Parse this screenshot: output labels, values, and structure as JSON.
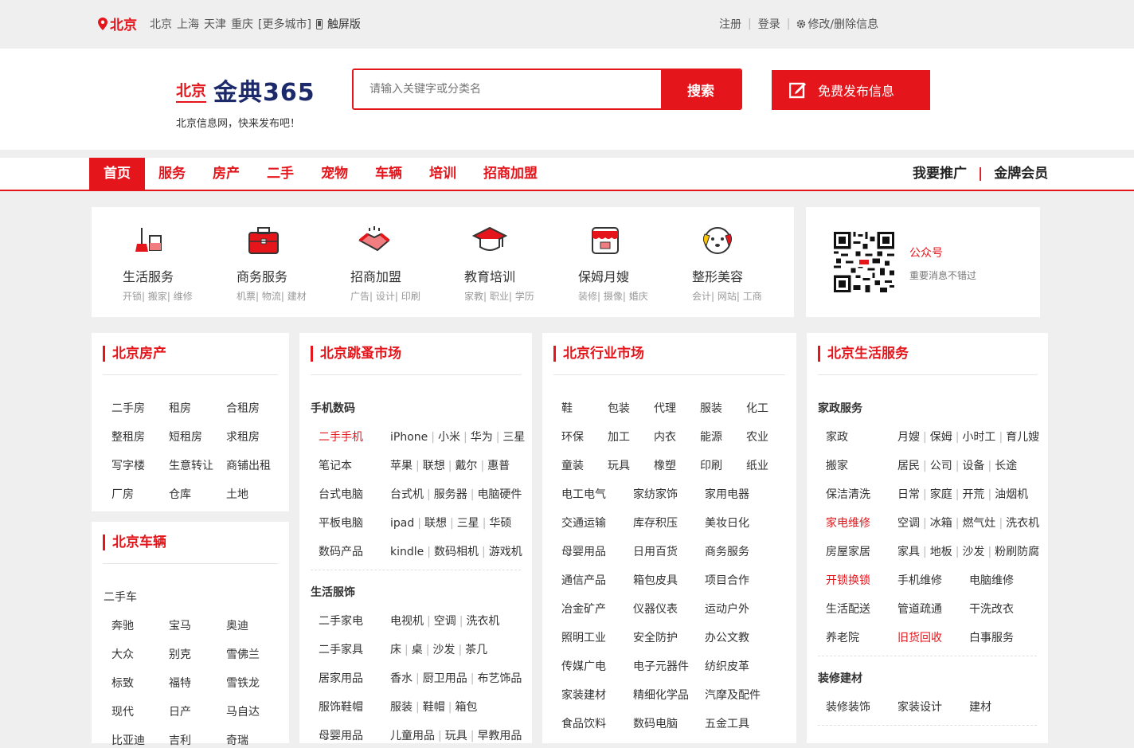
{
  "topbar": {
    "city": "北京",
    "cities": [
      "北京",
      "上海",
      "天津",
      "重庆"
    ],
    "more": "[更多城市]",
    "touch": "触屏版",
    "register": "注册",
    "login": "登录",
    "modify": "修改/删除信息"
  },
  "header": {
    "logo_city": "北京",
    "logo_name": "金典365",
    "slogan": "北京信息网，快来发布吧！",
    "search_placeholder": "请输入关键字或分类名",
    "search_button": "搜索",
    "publish_button": "免费发布信息"
  },
  "nav": {
    "items": [
      "首页",
      "服务",
      "房产",
      "二手",
      "宠物",
      "车辆",
      "培训",
      "招商加盟"
    ],
    "promote": "我要推广",
    "divider": "|",
    "gold": "金牌会员"
  },
  "categories": [
    {
      "name": "生活服务",
      "sub": "开锁| 搬家| 维修",
      "icon": "broom-icon"
    },
    {
      "name": "商务服务",
      "sub": "机票| 物流| 建材",
      "icon": "briefcase-icon"
    },
    {
      "name": "招商加盟",
      "sub": "广告| 设计| 印刷",
      "icon": "handshake-icon"
    },
    {
      "name": "教育培训",
      "sub": "家教| 职业| 学历",
      "icon": "graduation-cap-icon"
    },
    {
      "name": "保姆月嫂",
      "sub": "装修| 摄像| 婚庆",
      "icon": "storefront-icon"
    },
    {
      "name": "整形美容",
      "sub": "会计| 网站| 工商",
      "icon": "puppy-icon"
    }
  ],
  "wechat": {
    "title": "公众号",
    "desc": "重要消息不错过"
  },
  "house": {
    "title": "北京房产",
    "items": [
      "二手房",
      "租房",
      "合租房",
      "整租房",
      "短租房",
      "求租房",
      "写字楼",
      "生意转让",
      "商铺出租",
      "厂房",
      "仓库",
      "土地"
    ]
  },
  "vehicle": {
    "title": "北京车辆",
    "group": "二手车",
    "items": [
      "奔驰",
      "宝马",
      "奥迪",
      "大众",
      "别克",
      "雪佛兰",
      "标致",
      "福特",
      "雪铁龙",
      "现代",
      "日产",
      "马自达",
      "比亚迪",
      "吉利",
      "奇瑞"
    ]
  },
  "flea": {
    "title": "北京跳蚤市场",
    "group1": "手机数码",
    "rows1": [
      {
        "cat": "二手手机",
        "items": [
          "iPhone",
          "小米",
          "华为",
          "三星"
        ]
      },
      {
        "cat": "笔记本",
        "items": [
          "苹果",
          "联想",
          "戴尔",
          "惠普"
        ]
      },
      {
        "cat": "台式电脑",
        "items": [
          "台式机",
          "服务器",
          "电脑硬件"
        ]
      },
      {
        "cat": "平板电脑",
        "items": [
          "ipad",
          "联想",
          "三星",
          "华硕"
        ]
      },
      {
        "cat": "数码产品",
        "items": [
          "kindle",
          "数码相机",
          "游戏机"
        ]
      }
    ],
    "group2": "生活服饰",
    "rows2": [
      {
        "cat": "二手家电",
        "items": [
          "电视机",
          "空调",
          "洗衣机"
        ]
      },
      {
        "cat": "二手家具",
        "items": [
          "床",
          "桌",
          "沙发",
          "茶几"
        ]
      },
      {
        "cat": "居家用品",
        "items": [
          "香水",
          "厨卫用品",
          "布艺饰品"
        ]
      },
      {
        "cat": "服饰鞋帽",
        "items": [
          "服装",
          "鞋帽",
          "箱包"
        ]
      },
      {
        "cat": "母婴用品",
        "items": [
          "儿童用品",
          "玩具",
          "早教用品"
        ]
      }
    ]
  },
  "industry": {
    "title": "北京行业市场",
    "rows5": [
      [
        "鞋",
        "包装",
        "代理",
        "服装",
        "化工"
      ],
      [
        "环保",
        "加工",
        "内衣",
        "能源",
        "农业"
      ],
      [
        "童装",
        "玩具",
        "橡塑",
        "印刷",
        "纸业"
      ]
    ],
    "rows3": [
      [
        "电工电气",
        "家纺家饰",
        "家用电器"
      ],
      [
        "交通运输",
        "库存积压",
        "美妆日化"
      ],
      [
        "母婴用品",
        "日用百货",
        "商务服务"
      ],
      [
        "通信产品",
        "箱包皮具",
        "项目合作"
      ],
      [
        "冶金矿产",
        "仪器仪表",
        "运动户外"
      ],
      [
        "照明工业",
        "安全防护",
        "办公文教"
      ],
      [
        "传媒广电",
        "电子元器件",
        "纺织皮革"
      ],
      [
        "家装建材",
        "精细化学品",
        "汽摩及配件"
      ],
      [
        "食品饮料",
        "数码电脑",
        "五金工具"
      ]
    ]
  },
  "life": {
    "title": "北京生活服务",
    "group1": "家政服务",
    "rows1": [
      {
        "cat": "家政",
        "items": [
          "月嫂",
          "保姆",
          "小时工",
          "育儿嫂"
        ]
      },
      {
        "cat": "搬家",
        "items": [
          "居民",
          "公司",
          "设备",
          "长途"
        ]
      },
      {
        "cat": "保洁清洗",
        "items": [
          "日常",
          "家庭",
          "开荒",
          "油烟机"
        ]
      },
      {
        "cat": "家电维修",
        "items": [
          "空调",
          "冰箱",
          "燃气灶",
          "洗衣机"
        ]
      },
      {
        "cat": "房屋家居",
        "items": [
          "家具",
          "地板",
          "沙发",
          "粉刷防腐"
        ]
      }
    ],
    "rows2": [
      [
        "开锁换锁",
        "手机维修",
        "电脑维修"
      ],
      [
        "生活配送",
        "管道疏通",
        "干洗改衣"
      ],
      [
        "养老院",
        "旧货回收",
        "白事服务"
      ]
    ],
    "group2": "装修建材",
    "rows3": [
      "装修装饰",
      "家装设计",
      "建材"
    ]
  },
  "colors": {
    "accent": "#e4161c",
    "brand_blue": "#1c2a6b"
  }
}
